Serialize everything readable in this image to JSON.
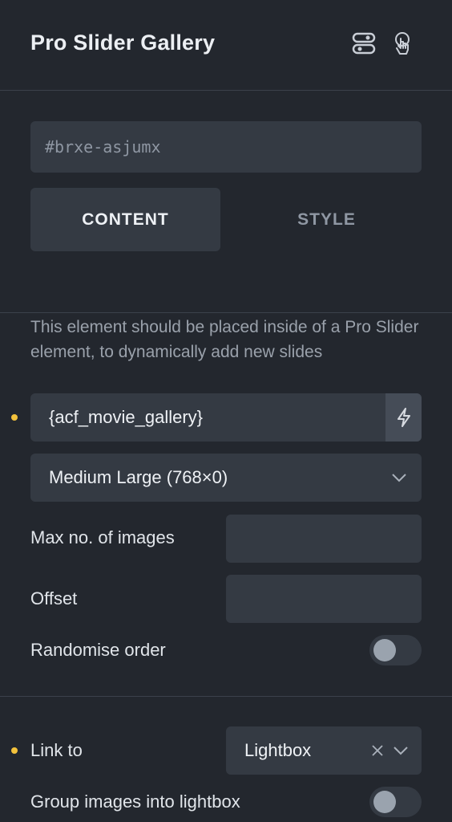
{
  "header": {
    "title": "Pro Slider Gallery",
    "icons": [
      "toggles-icon",
      "pointer-hand-icon"
    ]
  },
  "element_id": {
    "placeholder": "#brxe-asjumx"
  },
  "tabs": [
    {
      "label": "CONTENT",
      "active": true
    },
    {
      "label": "STYLE",
      "active": false
    }
  ],
  "info": {
    "text": "This element should be placed inside of a Pro Slider element, to dynamically add new slides"
  },
  "gallery_field": {
    "value": "{acf_movie_gallery}",
    "dynamic_icon": "lightning-icon"
  },
  "image_size": {
    "value": "Medium Large (768×0)"
  },
  "max_images": {
    "label": "Max no. of images",
    "value": ""
  },
  "offset": {
    "label": "Offset",
    "value": ""
  },
  "randomise": {
    "label": "Randomise order",
    "on": false
  },
  "link_to": {
    "label": "Link to",
    "value": "Lightbox"
  },
  "group_lightbox": {
    "label": "Group images into lightbox",
    "on": false
  },
  "colors": {
    "background": "#23272e",
    "field": "#343a43",
    "accent_dot": "#f3c23c"
  }
}
